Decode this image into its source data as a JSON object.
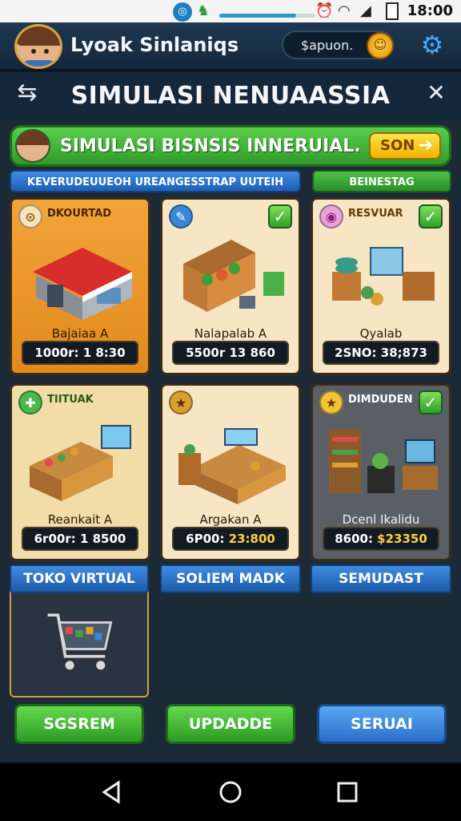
{
  "status_bar": {
    "time": "18:00",
    "progress_fraction": 0.8
  },
  "header": {
    "username": "Lyoak Sinlaniqs",
    "coin_text": "$apuon.",
    "settings_icon": "gear-icon"
  },
  "subheader": {
    "title": "SIMULASI NENUAASSIA",
    "back_icon": "back-arrow-icon",
    "close_icon": "close-icon"
  },
  "banner": {
    "title": "SIMULASI BISNSIS INNERUIAL.",
    "button_label": "SON"
  },
  "tabs": [
    {
      "label": "KEVERUDEUUEOH UREANGESSTRAP UUTEIH"
    },
    {
      "label": "BEINESTAG"
    }
  ],
  "cards": [
    {
      "label": "DKOURTAD",
      "name": "Bajaiaa A",
      "price": "1000r: 1 8:30",
      "price_highlight": "",
      "checked": false,
      "badge": "⊙"
    },
    {
      "label": "",
      "name": "Nalapalab A",
      "price": "5500r 13 860",
      "price_highlight": "",
      "checked": true,
      "badge": "✎"
    },
    {
      "label": "RESVUAR",
      "name": "Qyalab",
      "price": "2SNO: 38;873",
      "price_highlight": "",
      "checked": true,
      "badge": "◉"
    },
    {
      "label": "TIITUAK",
      "name": "Reankait A",
      "price": "6r00r: 1 8500",
      "price_highlight": "",
      "checked": false,
      "badge": "✚"
    },
    {
      "label": "",
      "name": "Argakan A",
      "price": "6P00: ",
      "price_highlight": "23:800",
      "checked": false,
      "badge": "★"
    },
    {
      "label": "DIMDUDEN",
      "name": "Dcenl Ikalidu",
      "price": "8600: ",
      "price_highlight": "$23350",
      "checked": true,
      "badge": "★"
    }
  ],
  "categories": [
    {
      "label": "TOKO VIRTUAL"
    },
    {
      "label": "SOLIEM MADK"
    },
    {
      "label": "SEMUDAST"
    }
  ],
  "actions": [
    {
      "label": "SGSREM"
    },
    {
      "label": "UPDADDE"
    },
    {
      "label": "SERUAI"
    }
  ],
  "colors": {
    "accent_green": "#3fb234",
    "accent_blue": "#2a6fc8",
    "card_orange": "#e8951f",
    "price_yellow": "#ffd23a"
  }
}
